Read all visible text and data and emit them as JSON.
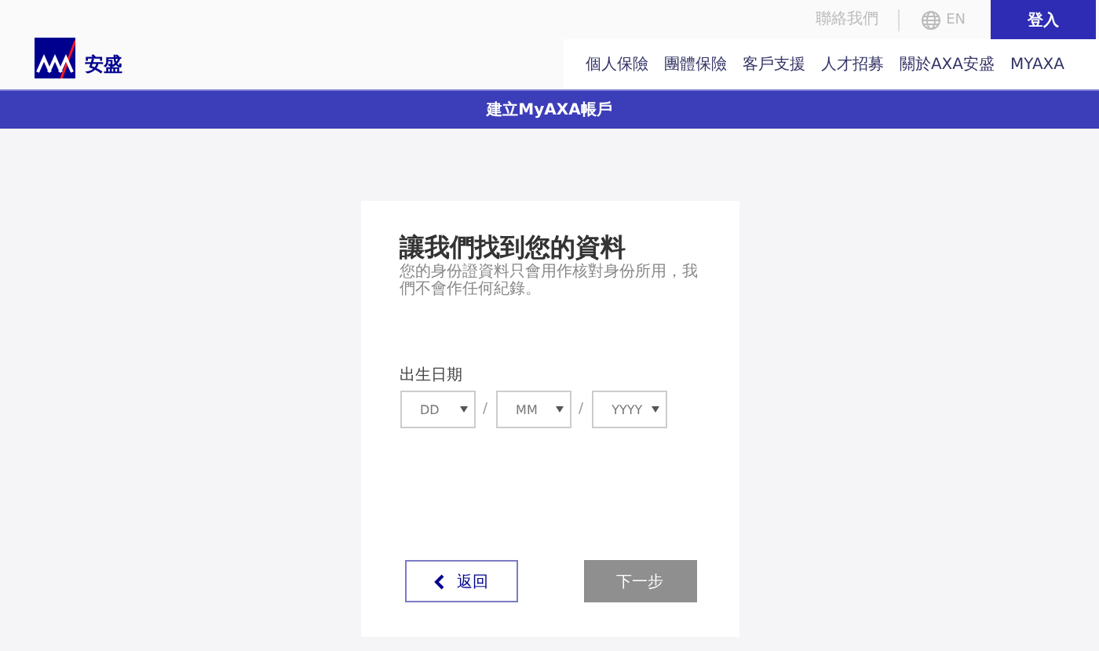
{
  "header": {
    "logo_text": "安盛",
    "contact_link": "聯絡我們",
    "language": "EN",
    "login_button": "登入",
    "nav": [
      {
        "label": "個人保險"
      },
      {
        "label": "團體保險"
      },
      {
        "label": "客戶支援"
      },
      {
        "label": "人才招募"
      },
      {
        "label": "關於AXA安盛"
      },
      {
        "label": "MYAXA"
      }
    ]
  },
  "banner": {
    "title": "建立MyAXA帳戶"
  },
  "card": {
    "title": "讓我們找到您的資料",
    "description": "您的身份證資料只會用作核對身份所用，我們不會作任何紀錄。",
    "date_label": "出生日期",
    "date_fields": [
      {
        "placeholder": "DD"
      },
      {
        "placeholder": "MM"
      },
      {
        "placeholder": "YYYY"
      }
    ],
    "separators": [
      "/",
      "/"
    ],
    "back_button": {
      "label": "返回",
      "disabled": false
    },
    "next_button": {
      "label": "下一步",
      "disabled": true
    }
  }
}
